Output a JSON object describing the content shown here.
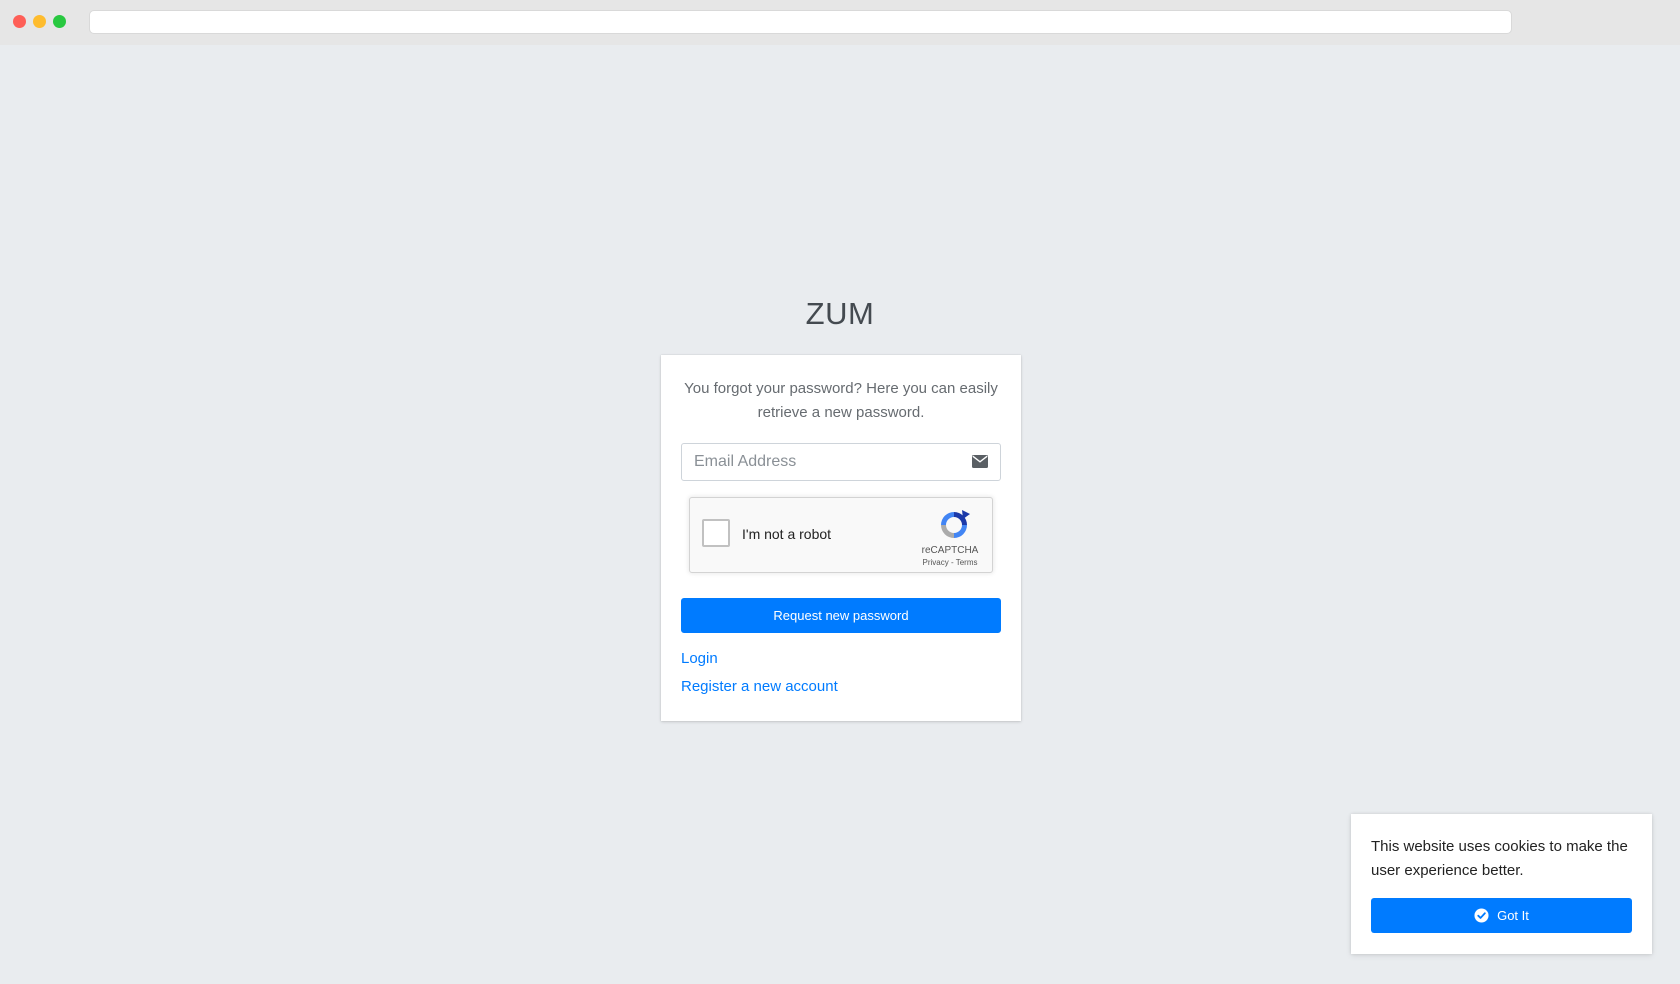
{
  "app": {
    "logo": "ZUM"
  },
  "card": {
    "intro": "You forgot your password? Here you can easily retrieve a new password.",
    "email_placeholder": "Email Address",
    "email_value": "",
    "email_icon": "envelope-icon",
    "captcha": {
      "label": "I'm not a robot",
      "brand": "reCAPTCHA",
      "privacy": "Privacy",
      "separator": " - ",
      "terms": "Terms",
      "icon": "recaptcha-logo-icon"
    },
    "submit_label": "Request new password",
    "login_link": "Login",
    "register_link": "Register a new account"
  },
  "cookie_banner": {
    "text": "This website uses cookies to make the user experience better.",
    "button_label": "Got It",
    "button_icon": "check-circle-icon"
  },
  "colors": {
    "primary": "#007bff",
    "background": "#e9ecef"
  }
}
